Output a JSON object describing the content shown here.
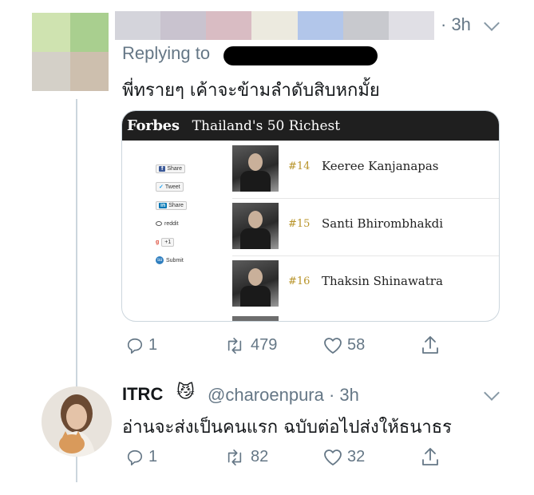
{
  "tweet1": {
    "author_mosaic_colors": [
      "#cfe3b0",
      "#a9cf8f",
      "#d4d0c8",
      "#cdbfae"
    ],
    "name_blur_colors": [
      "#d4d4db",
      "#c9c3cf",
      "#d9bcc3",
      "#eceadf",
      "#b2c6ea",
      "#c8c9ce",
      "#e0dfe5"
    ],
    "time": "· 3h",
    "replying_to_label": "Replying to",
    "text": "พี่ทรายๆ เค้าจะข้ามลำดับสิบหกมั้ย",
    "card": {
      "logo": "Forbes",
      "subtitle": "Thailand's 50 Richest",
      "share_buttons": [
        {
          "icon": "facebook-icon",
          "label": "Share"
        },
        {
          "icon": "twitter-icon",
          "label": "Tweet"
        },
        {
          "icon": "linkedin-icon",
          "label": "Share"
        },
        {
          "icon": "reddit-icon",
          "label": "reddit"
        },
        {
          "icon": "google-plus-icon",
          "label": "+1"
        },
        {
          "icon": "stumbleupon-icon",
          "label": "Submit"
        }
      ],
      "ranks": [
        {
          "rank": "#14",
          "name": "Keeree Kanjanapas"
        },
        {
          "rank": "#15",
          "name": "Santi Bhirombhakdi"
        },
        {
          "rank": "#16",
          "name": "Thaksin Shinawatra"
        }
      ]
    },
    "actions": {
      "replies": "1",
      "retweets": "479",
      "likes": "58"
    }
  },
  "tweet2": {
    "name": "ITRC",
    "emoji": "😼",
    "handle_time": "@charoenpura · 3h",
    "text": "อ่านจะส่งเป็นคนแรก ฉบับต่อไปส่งให้ธนาธร",
    "actions": {
      "replies": "1",
      "retweets": "82",
      "likes": "32"
    }
  }
}
